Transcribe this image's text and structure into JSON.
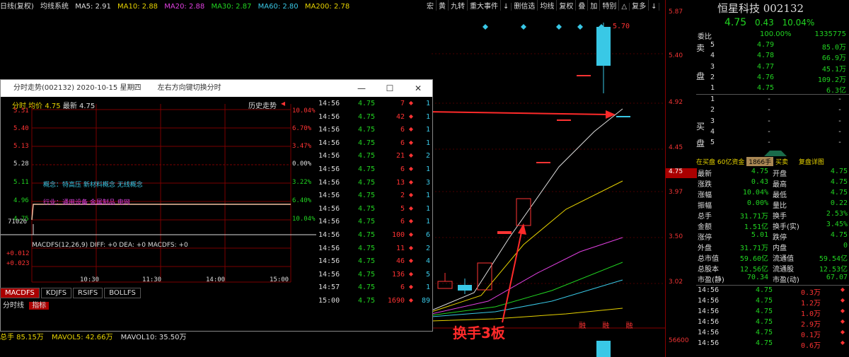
{
  "top_legend": {
    "name": "日线(复权)",
    "indicator": "均线系统",
    "ma5": "MA5: 2.91",
    "ma10": "MA10: 2.88",
    "ma20": "MA20: 2.88",
    "ma30": "MA30: 2.87",
    "ma60": "MA60: 2.80",
    "ma200": "MA200: 2.78"
  },
  "toolbar": [
    "宏",
    "黄",
    "九转",
    "重大事件",
    "↓",
    "删信选",
    "均线",
    "复权",
    "叠",
    "加",
    "特别",
    "△",
    "复多",
    "↓"
  ],
  "price_axis": [
    "5.87",
    "5.40",
    "4.92",
    "4.45",
    "3.97",
    "3.50",
    "3.02",
    "56600"
  ],
  "price_highlight": "4.75",
  "candle_label": "5.70",
  "annotation": "换手3板",
  "bottom_bar": {
    "volume": "总手 85.15万",
    "mavol5": "MAVOL5: 42.66万",
    "mavol10": "MAVOL10: 35.50万"
  },
  "bottom_markers": [
    "融",
    "融",
    "融"
  ],
  "popup": {
    "title": "分时走势(002132) 2020-10-15 星期四",
    "hint": "左右方向键切换分时",
    "header": {
      "label": "分时 均价",
      "avg": "4.75",
      "last_label": "最新",
      "last": "4.75"
    },
    "history_btn": "历史走势",
    "left_ticks": [
      "5.51",
      "5.40",
      "5.13",
      "5.28",
      "5.11",
      "4.96",
      "4.75"
    ],
    "right_ticks": [
      "10.04%",
      "6.70%",
      "3.47%",
      "0.00%",
      "3.22%",
      "6.40%",
      "10.04%"
    ],
    "concept1": "概念：特高压  新材料概念  无线概念",
    "concept2": "行业：通用设备  金属制品  电网",
    "vol_tick": "71026",
    "time_ticks": [
      "10:30",
      "11:30",
      "14:00",
      "15:00"
    ],
    "macd_legend": "MACDFS(12,26,9) DIFF: +0  DEA: +0  MACDFS: +0",
    "macd_ticks": [
      "+0.012",
      "+0.023"
    ],
    "ticks": [
      {
        "time": "14:56",
        "price": "4.75",
        "vol": "7",
        "flag": "1"
      },
      {
        "time": "14:56",
        "price": "4.75",
        "vol": "42",
        "flag": "1"
      },
      {
        "time": "14:56",
        "price": "4.75",
        "vol": "6",
        "flag": "1"
      },
      {
        "time": "14:56",
        "price": "4.75",
        "vol": "6",
        "flag": "1"
      },
      {
        "time": "14:56",
        "price": "4.75",
        "vol": "21",
        "flag": "2"
      },
      {
        "time": "14:56",
        "price": "4.75",
        "vol": "6",
        "flag": "1"
      },
      {
        "time": "14:56",
        "price": "4.75",
        "vol": "13",
        "flag": "3"
      },
      {
        "time": "14:56",
        "price": "4.75",
        "vol": "2",
        "flag": "1"
      },
      {
        "time": "14:56",
        "price": "4.75",
        "vol": "5",
        "flag": "1"
      },
      {
        "time": "14:56",
        "price": "4.75",
        "vol": "6",
        "flag": "1"
      },
      {
        "time": "14:56",
        "price": "4.75",
        "vol": "100",
        "flag": "6"
      },
      {
        "time": "14:56",
        "price": "4.75",
        "vol": "11",
        "flag": "2"
      },
      {
        "time": "14:56",
        "price": "4.75",
        "vol": "46",
        "flag": "4"
      },
      {
        "time": "14:56",
        "price": "4.75",
        "vol": "136",
        "flag": "5"
      },
      {
        "time": "14:57",
        "price": "4.75",
        "vol": "6",
        "flag": "1"
      },
      {
        "time": "15:00",
        "price": "4.75",
        "vol": "1690",
        "flag": "89"
      }
    ]
  },
  "indicator_tabs": [
    "MACDFS",
    "KDJFS",
    "RSIFS",
    "BOLLFS"
  ],
  "sub_tabs": [
    "分时线",
    "指标"
  ],
  "right_panel": {
    "name": "恒星科技 002132",
    "price": "4.75",
    "change": "0.43",
    "pct": "10.04%",
    "weibi_label": "委比",
    "weibi": "100.00%",
    "weicha": "1335775",
    "sell_label": [
      "卖",
      "盘"
    ],
    "buy_label": [
      "买",
      "盘"
    ],
    "sells": [
      {
        "lvl": "5",
        "price": "4.79",
        "vol": "85.0万"
      },
      {
        "lvl": "4",
        "price": "4.78",
        "vol": "66.9万"
      },
      {
        "lvl": "3",
        "price": "4.77",
        "vol": "45.1万"
      },
      {
        "lvl": "2",
        "price": "4.76",
        "vol": "109.2万"
      },
      {
        "lvl": "1",
        "price": "4.75",
        "vol": "6.3亿"
      }
    ],
    "buys": [
      {
        "lvl": "1",
        "price": "-",
        "vol": "-"
      },
      {
        "lvl": "2",
        "price": "-",
        "vol": "-"
      },
      {
        "lvl": "3",
        "price": "-",
        "vol": "-"
      },
      {
        "lvl": "4",
        "price": "-",
        "vol": "-"
      },
      {
        "lvl": "5",
        "price": "-",
        "vol": "-"
      }
    ],
    "status": {
      "s1": "在买盘",
      "s2": "60亿资金",
      "s3": "1866手",
      "s4": "买卖",
      "s5": "复盘详图"
    },
    "stats": [
      {
        "k1": "最新",
        "v1": "4.75",
        "k2": "开盘",
        "v2": "4.75"
      },
      {
        "k1": "涨跌",
        "v1": "0.43",
        "k2": "最高",
        "v2": "4.75"
      },
      {
        "k1": "涨幅",
        "v1": "10.04%",
        "k2": "最低",
        "v2": "4.75"
      },
      {
        "k1": "振幅",
        "v1": "0.00%",
        "k2": "量比",
        "v2": "0.22"
      },
      {
        "k1": "总手",
        "v1": "31.71万",
        "k2": "换手",
        "v2": "2.53%"
      },
      {
        "k1": "金额",
        "v1": "1.51亿",
        "k2": "换手(实)",
        "v2": "3.45%"
      },
      {
        "k1": "涨停",
        "v1": "5.01",
        "k2": "跌停",
        "v2": "4.75"
      },
      {
        "k1": "外盘",
        "v1": "31.71万",
        "k2": "内盘",
        "v2": "0"
      },
      {
        "k1": "总市值",
        "v1": "59.60亿",
        "k2": "流通值",
        "v2": "59.54亿"
      },
      {
        "k1": "总股本",
        "v1": "12.56亿",
        "k2": "流通股",
        "v2": "12.53亿"
      },
      {
        "k1": "市盈(静)",
        "v1": "70.34",
        "k2": "市盈(动)",
        "v2": "67.07"
      }
    ],
    "trades": [
      {
        "time": "14:56",
        "price": "4.75",
        "vol": "0.3万"
      },
      {
        "time": "14:56",
        "price": "4.75",
        "vol": "1.2万"
      },
      {
        "time": "14:56",
        "price": "4.75",
        "vol": "1.0万"
      },
      {
        "time": "14:56",
        "price": "4.75",
        "vol": "2.9万"
      },
      {
        "time": "14:56",
        "price": "4.75",
        "vol": "0.1万"
      },
      {
        "time": "14:56",
        "price": "4.75",
        "vol": "0.6万"
      }
    ]
  },
  "colors": {
    "up": "#ff3333",
    "down": "#21d321",
    "cyan": "#39c8e6",
    "bg": "#000000"
  }
}
